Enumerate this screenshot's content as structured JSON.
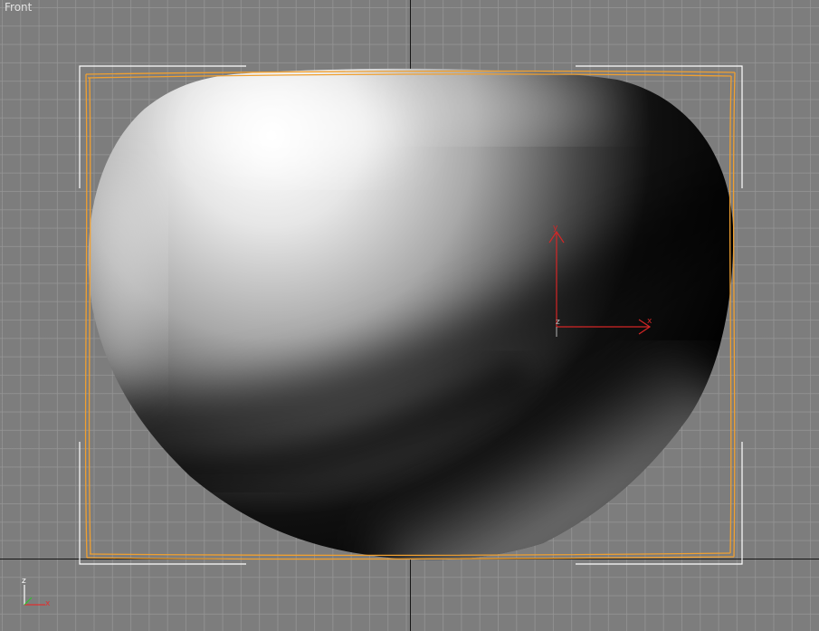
{
  "viewport": {
    "label": "Front"
  },
  "gizmo": {
    "x_label": "x",
    "y_label": "y",
    "z_label": "z",
    "color": "#d42626"
  },
  "axis_tripod": {
    "x_label": "x",
    "z_label": "z",
    "x_color": "#e03030",
    "z_color": "#ffffff",
    "y_color": "#30c030"
  },
  "colors": {
    "background": "#7d7d7d",
    "grid_line": "#969696",
    "home_grid_axis": "#151515",
    "selection_bracket": "#ffffff",
    "bounding_box": "#f0a030"
  }
}
